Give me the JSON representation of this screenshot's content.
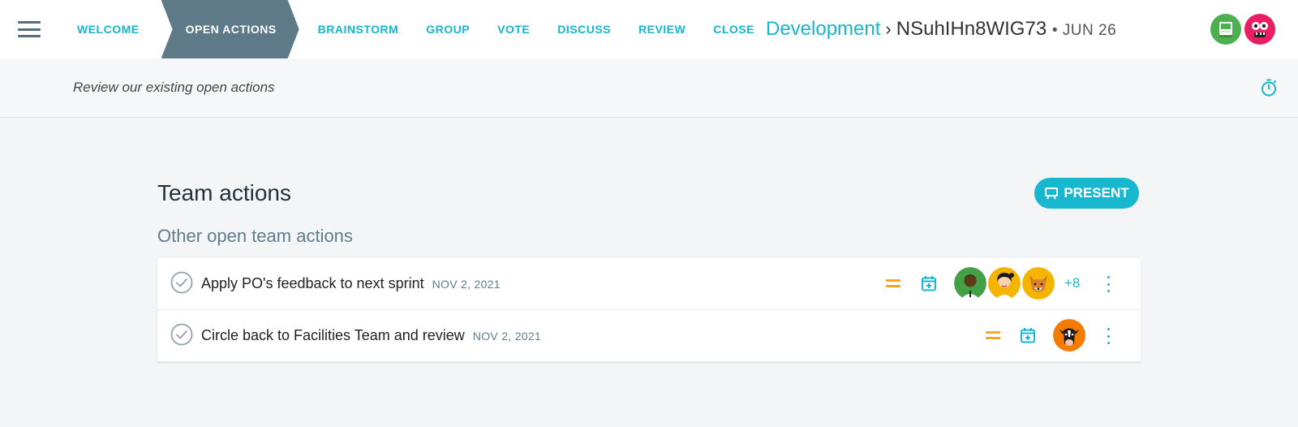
{
  "header": {
    "stages": [
      {
        "label": "WELCOME"
      },
      {
        "label": "OPEN ACTIONS"
      },
      {
        "label": "BRAINSTORM"
      },
      {
        "label": "GROUP"
      },
      {
        "label": "VOTE"
      },
      {
        "label": "DISCUSS"
      },
      {
        "label": "REVIEW"
      },
      {
        "label": "CLOSE"
      }
    ],
    "active_stage": "OPEN ACTIONS",
    "breadcrumb": {
      "team": "Development",
      "separator": "›",
      "board": "NSuhIHn8WIG73",
      "date": "• JUN 26..."
    },
    "participants": [
      {
        "icon": "sticky-note-avatar-icon",
        "color": "#4caf50"
      },
      {
        "icon": "monster-avatar-icon",
        "color": "#e91e63"
      }
    ]
  },
  "subbar": {
    "hint": "Review our existing open actions",
    "timer_icon": "stopwatch-icon"
  },
  "main": {
    "title": "Team actions",
    "present_label": "PRESENT",
    "subtitle": "Other open team actions",
    "actions": [
      {
        "title": "Apply PO's feedback to next sprint",
        "due": "NOV 2, 2021",
        "priority_icon": "equals-priority-icon",
        "assignees": [
          "person-avatar-icon",
          "woman-avatar-icon",
          "fox-avatar-icon"
        ],
        "more": "+8"
      },
      {
        "title": "Circle back to Facilities Team and review",
        "due": "NOV 2, 2021",
        "priority_icon": "equals-priority-icon",
        "assignees": [
          "cow-avatar-icon"
        ],
        "more": ""
      }
    ]
  },
  "colors": {
    "accent": "#16b5cc",
    "active_stage": "#5e7a88",
    "priority": "#f5a623"
  }
}
